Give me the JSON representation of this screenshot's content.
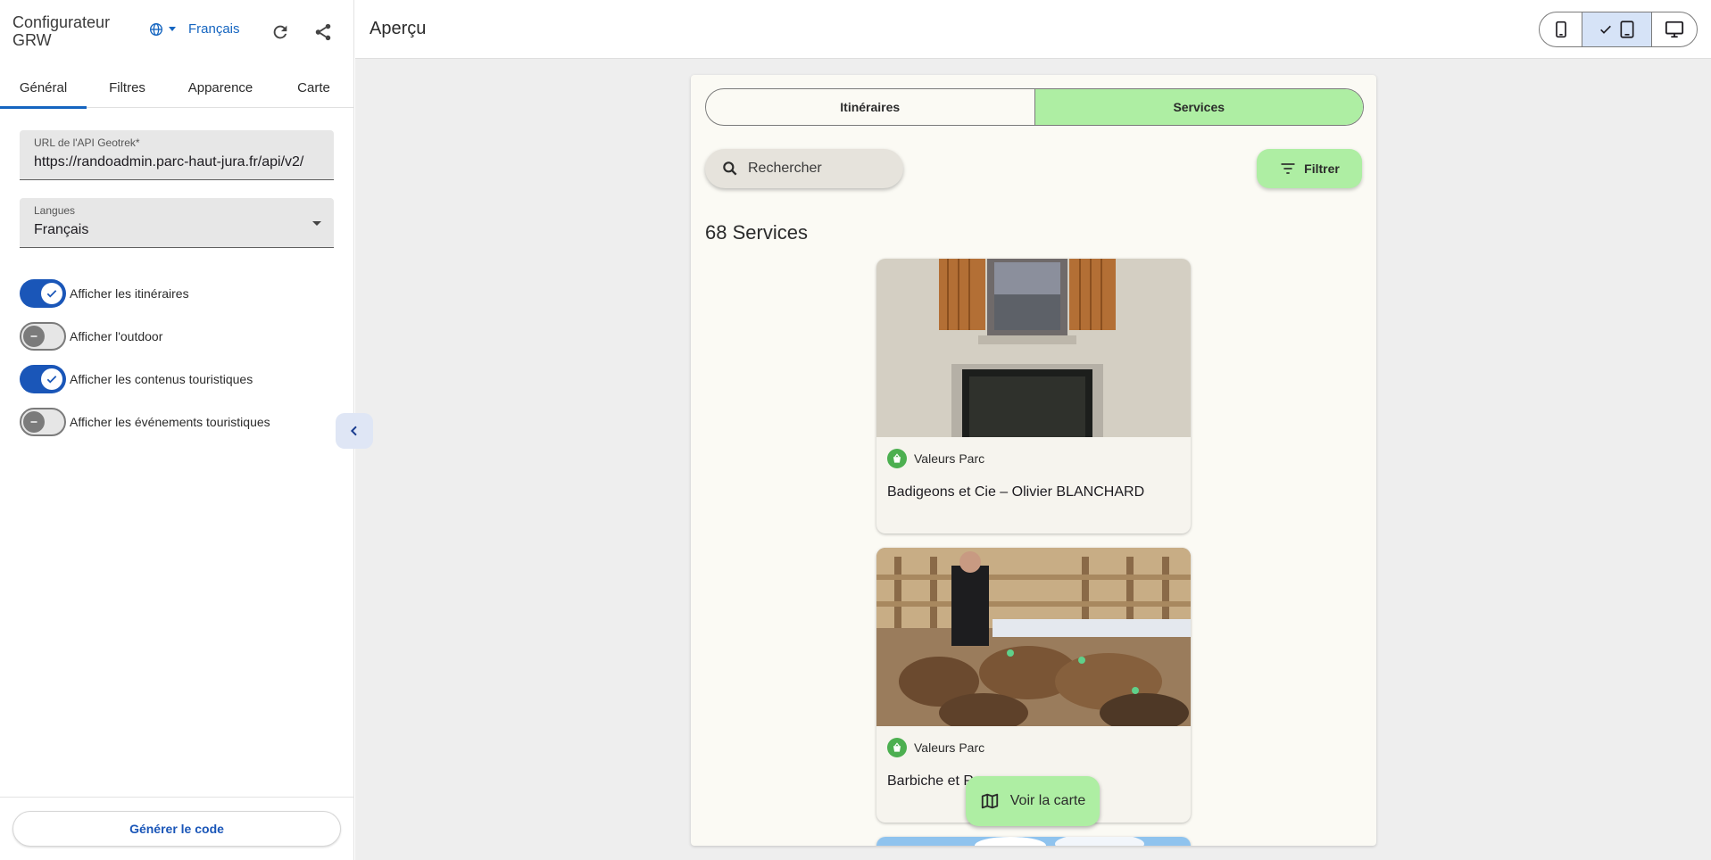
{
  "sidebar": {
    "title": "Configurateur GRW",
    "language_switch": "Français",
    "tabs": [
      "Général",
      "Filtres",
      "Apparence",
      "Carte"
    ],
    "api_field": {
      "label": "URL de l'API Geotrek*",
      "value": "https://randoadmin.parc-haut-jura.fr/api/v2/"
    },
    "languages_field": {
      "label": "Langues",
      "value": "Français"
    },
    "toggles": [
      {
        "label": "Afficher les itinéraires",
        "on": true
      },
      {
        "label": "Afficher l'outdoor",
        "on": false
      },
      {
        "label": "Afficher les contenus touristiques",
        "on": true
      },
      {
        "label": "Afficher les événements touristiques",
        "on": false
      }
    ],
    "generate_button": "Générer le code"
  },
  "main": {
    "title": "Aperçu",
    "device_selected": "tablet",
    "preview": {
      "segments": [
        "Itinéraires",
        "Services"
      ],
      "active_segment": "Services",
      "search_placeholder": "Rechercher",
      "filter_button": "Filtrer",
      "results_count": "68 Services",
      "cards": [
        {
          "category": "Valeurs Parc",
          "name": "Badigeons et Cie – Olivier BLANCHARD"
        },
        {
          "category": "Valeurs Parc",
          "name": "Barbiche et R"
        }
      ],
      "map_button": "Voir la carte"
    }
  },
  "colors": {
    "primary": "#1a56b8",
    "accent_green": "#aeeea3",
    "preview_bg": "#fbfaf4"
  }
}
